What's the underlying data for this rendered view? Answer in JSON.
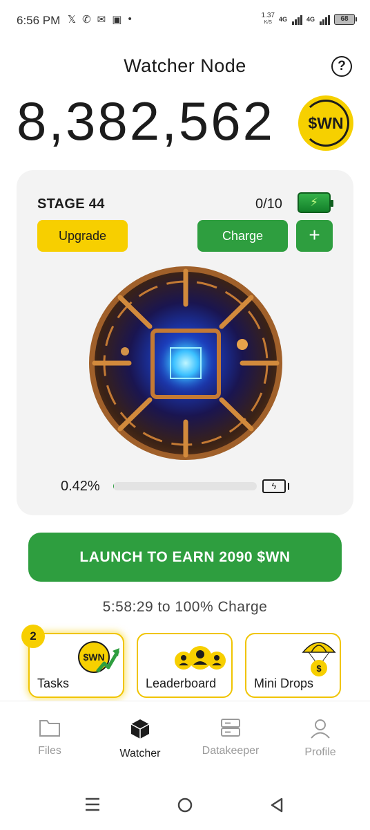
{
  "status_bar": {
    "time": "6:56 PM",
    "data_rate_value": "1.37",
    "data_rate_unit": "K/S",
    "network1": "4G",
    "network2": "4G",
    "battery": "68"
  },
  "header": {
    "title": "Watcher Node",
    "balance": "8,382,562",
    "coin_label": "$WN"
  },
  "node_card": {
    "stage": "STAGE 44",
    "charges": "0/10",
    "upgrade_label": "Upgrade",
    "charge_label": "Charge",
    "plus_label": "+",
    "progress_text": "0.42%",
    "progress_value": 0.0042
  },
  "launch": {
    "label": "LAUNCH TO EARN 2090 $WN",
    "timer": "5:58:29 to 100% Charge"
  },
  "shortcuts": {
    "tasks_label": "Tasks",
    "tasks_badge": "2",
    "tasks_coin": "$WN",
    "leaderboard_label": "Leaderboard",
    "minidrops_label": "Mini Drops"
  },
  "bottom_nav": {
    "files": "Files",
    "watcher": "Watcher",
    "datakeeper": "Datakeeper",
    "profile": "Profile",
    "active": "watcher"
  },
  "colors": {
    "accent_green": "#2e9e3f",
    "accent_yellow": "#f7cf00",
    "card_bg": "#f3f3f3"
  }
}
